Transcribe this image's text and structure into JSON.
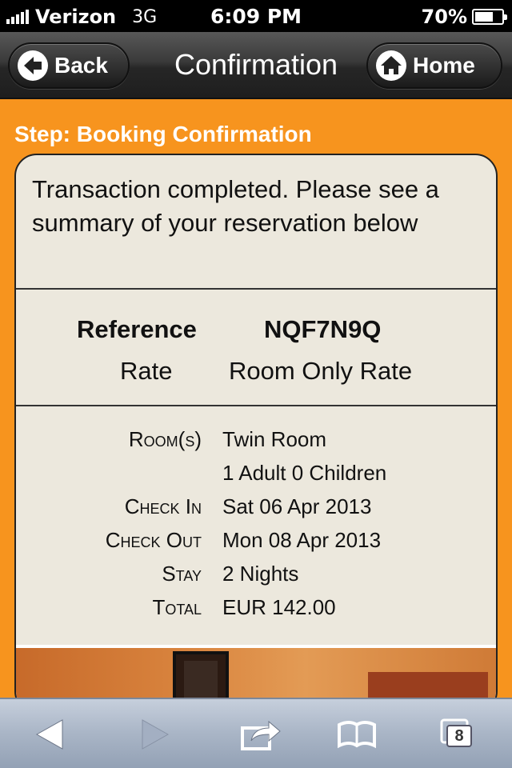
{
  "status_bar": {
    "carrier": "Verizon",
    "network": "3G",
    "time": "6:09 PM",
    "battery": "70%",
    "battery_level": 0.7
  },
  "nav": {
    "back_label": "Back",
    "title": "Confirmation",
    "home_label": "Home"
  },
  "step": "Step: Booking Confirmation",
  "intro": "Transaction completed. Please see a summary of your reservation below",
  "reference": {
    "label": "Reference",
    "value": "NQF7N9Q"
  },
  "rate": {
    "label": "Rate",
    "value": "Room Only Rate"
  },
  "details": [
    {
      "label": "Room(s)",
      "value": "Twin Room"
    },
    {
      "label": "",
      "value": "1 Adult 0 Children"
    },
    {
      "label": "Check In",
      "value": "Sat 06 Apr 2013"
    },
    {
      "label": "Check Out",
      "value": "Mon 08 Apr 2013"
    },
    {
      "label": "Stay",
      "value": "2 Nights"
    },
    {
      "label": "Total",
      "value": "EUR 142.00"
    }
  ],
  "toolbar": {
    "tab_count": "8",
    "icons": [
      "back-arrow-icon",
      "forward-arrow-icon",
      "share-icon",
      "bookmarks-icon",
      "tabs-icon"
    ]
  },
  "colors": {
    "background": "#f7941e",
    "card": "#ece8dd",
    "navbar": "#2a2a2a"
  }
}
